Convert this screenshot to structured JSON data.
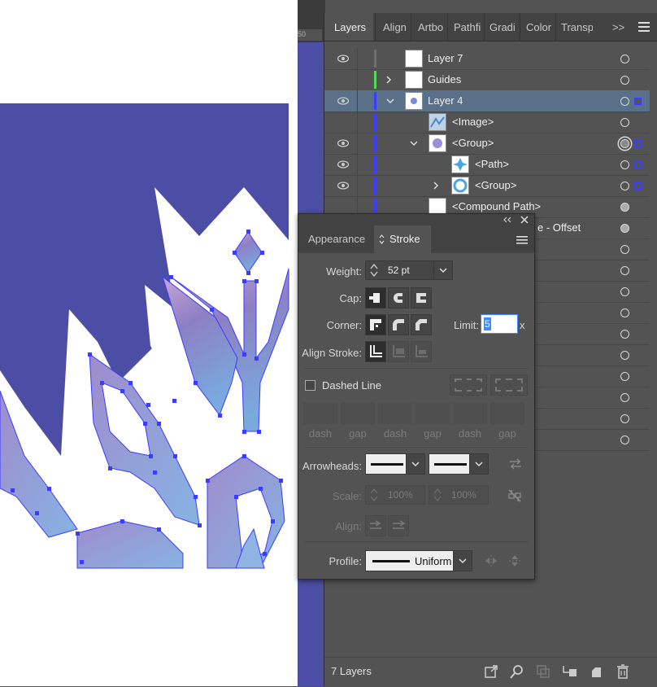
{
  "colors": {
    "canvas_blue": "#4b4ea4",
    "selection": "#3a3cff",
    "guides_green": "#53d75b"
  },
  "ruler": {
    "tick_label": "50"
  },
  "layers_panel": {
    "tabs": [
      "Layers",
      "Align",
      "Artbo",
      "Pathfi",
      "Gradi",
      "Color",
      "Transp"
    ],
    "overflow_label": ">>",
    "menu_icon": "hamburger-menu-icon",
    "rows": [
      {
        "name": "Layer 7"
      },
      {
        "name": "Guides"
      },
      {
        "name": "Layer 4"
      },
      {
        "name": "<Image>"
      },
      {
        "name": "<Group>"
      },
      {
        "name": "<Path>"
      },
      {
        "name": "<Group>"
      },
      {
        "name": "<Compound Path>"
      },
      {
        "name": "e - Offset"
      }
    ],
    "footer": {
      "count_label": "7 Layers"
    }
  },
  "stroke_panel": {
    "tabs": {
      "appearance": "Appearance",
      "stroke": "Stroke"
    },
    "weight": {
      "label": "Weight:",
      "value": "52 pt"
    },
    "cap": {
      "label": "Cap:"
    },
    "corner": {
      "label": "Corner:",
      "limit_label": "Limit:",
      "limit_value": "5",
      "limit_unit": "x"
    },
    "align_stroke": {
      "label": "Align Stroke:"
    },
    "dashed": {
      "label": "Dashed Line",
      "checked": false,
      "fields": [
        "dash",
        "gap",
        "dash",
        "gap",
        "dash",
        "gap"
      ]
    },
    "arrowheads": {
      "label": "Arrowheads:"
    },
    "scale": {
      "label": "Scale:",
      "start": "100%",
      "end": "100%"
    },
    "align": {
      "label": "Align:"
    },
    "profile": {
      "label": "Profile:",
      "value": "Uniform"
    }
  }
}
